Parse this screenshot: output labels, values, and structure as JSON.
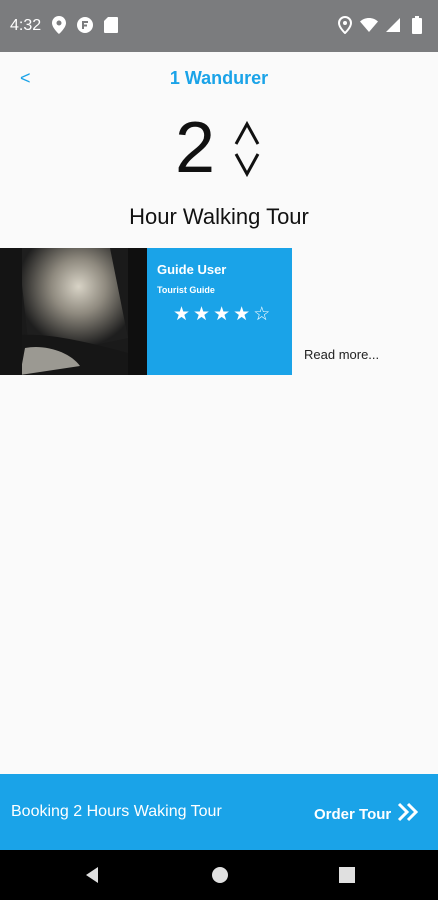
{
  "status_bar": {
    "time": "4:32",
    "left_icons": [
      "location-pin-icon",
      "notification-app-icon",
      "sd-card-icon"
    ],
    "right_icons": [
      "location-icon",
      "wifi-icon",
      "signal-icon",
      "battery-icon"
    ]
  },
  "header": {
    "back_label": "<",
    "title": "1 Wandurer"
  },
  "tour": {
    "hours": "2",
    "subtitle": "Hour Walking Tour"
  },
  "guide": {
    "name": "Guide User",
    "role": "Tourist Guide",
    "rating": 4,
    "rating_max": 5,
    "read_more": "Read more..."
  },
  "bottom_bar": {
    "booking_text": "Booking 2 Hours Waking Tour",
    "order_label": "Order Tour"
  },
  "colors": {
    "accent": "#1aa3e8",
    "status_bar": "#7b7c7e",
    "background": "#fafafa"
  }
}
